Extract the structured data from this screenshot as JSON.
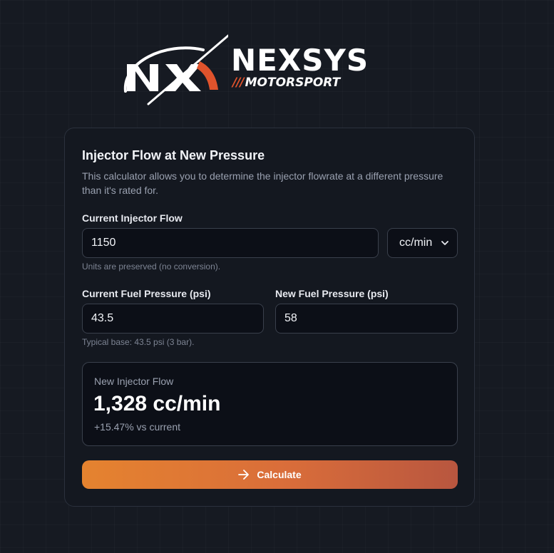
{
  "brand": {
    "name": "NEXSYS",
    "sub_prefix": "///",
    "sub": "MOTORSPORT",
    "accent": "#e0532c"
  },
  "calculator": {
    "title": "Injector Flow at New Pressure",
    "description": "This calculator allows you to determine the injector flowrate at a different pressure than it's rated for.",
    "flow_label": "Current Injector Flow",
    "flow_value": "1150",
    "unit_selected": "cc/min",
    "flow_hint": "Units are preserved (no conversion).",
    "current_pressure_label": "Current Fuel Pressure (psi)",
    "current_pressure_value": "43.5",
    "new_pressure_label": "New Fuel Pressure (psi)",
    "new_pressure_value": "58",
    "pressure_hint": "Typical base: 43.5 psi (3 bar).",
    "result_label": "New Injector Flow",
    "result_value": "1,328 cc/min",
    "result_delta": "+15.47% vs current",
    "button_label": "Calculate",
    "button_gradient": [
      "#e5832f",
      "#b8563f"
    ]
  }
}
